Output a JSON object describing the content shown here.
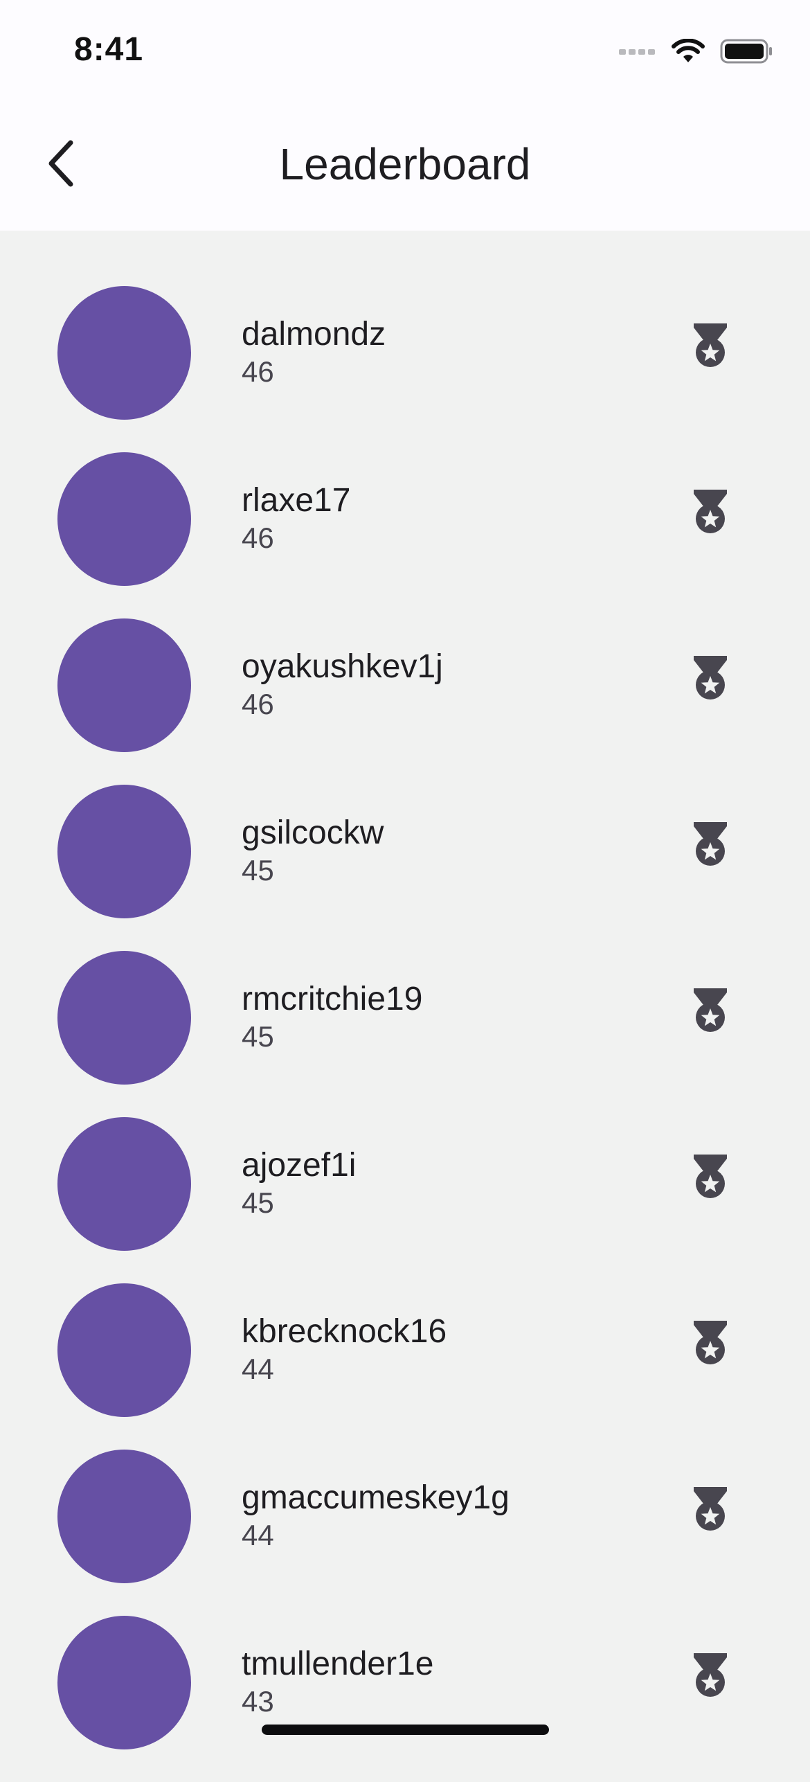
{
  "status_bar": {
    "time": "8:41"
  },
  "header": {
    "title": "Leaderboard",
    "back_icon": "chevron-left-icon"
  },
  "colors": {
    "avatar": "#6650a4",
    "background": "#f1f2f1",
    "header": "#fdfcff",
    "medal": "#48464f"
  },
  "leaderboard": [
    {
      "name": "dalmondz",
      "score": "46",
      "icon": "medal-icon"
    },
    {
      "name": "rlaxe17",
      "score": "46",
      "icon": "medal-icon"
    },
    {
      "name": "oyakushkev1j",
      "score": "46",
      "icon": "medal-icon"
    },
    {
      "name": "gsilcockw",
      "score": "45",
      "icon": "medal-icon"
    },
    {
      "name": "rmcritchie19",
      "score": "45",
      "icon": "medal-icon"
    },
    {
      "name": "ajozef1i",
      "score": "45",
      "icon": "medal-icon"
    },
    {
      "name": "kbrecknock16",
      "score": "44",
      "icon": "medal-icon"
    },
    {
      "name": "gmaccumeskey1g",
      "score": "44",
      "icon": "medal-icon"
    },
    {
      "name": "tmullender1e",
      "score": "43",
      "icon": "medal-icon"
    }
  ]
}
